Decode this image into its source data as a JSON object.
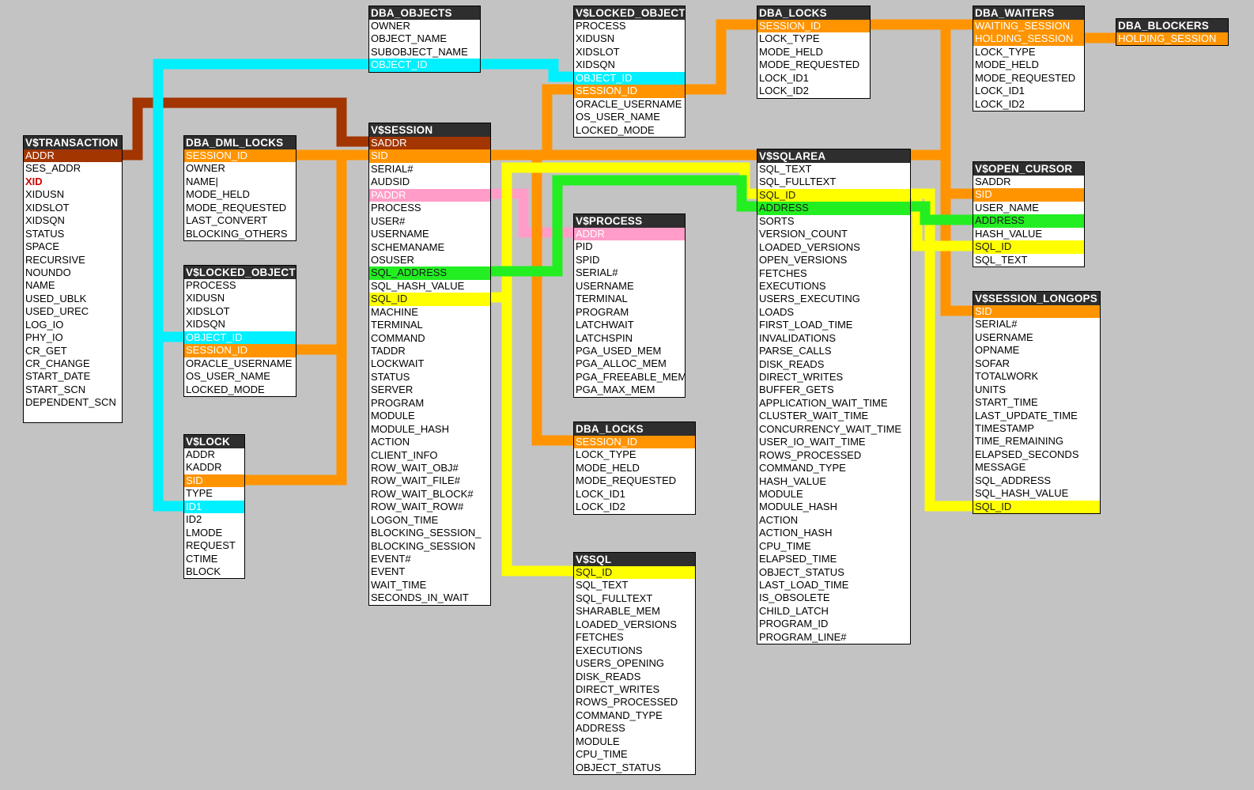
{
  "colors": {
    "background": "#c3c3c3",
    "header": "#2e2e2e",
    "orange": "#ff9400",
    "cyan": "#00f0ff",
    "brown": "#a23500",
    "yellow": "#ffff00",
    "green": "#22ee22",
    "pink": "#ff9cc8",
    "red_text": "#d00000"
  },
  "tables": [
    {
      "id": "vtransaction",
      "title": "V$TRANSACTION",
      "fields": [
        {
          "name": "ADDR",
          "hl": "brown"
        },
        {
          "name": "SES_ADDR"
        },
        {
          "name": "XID",
          "style": "red"
        },
        {
          "name": "XIDUSN"
        },
        {
          "name": "XIDSLOT"
        },
        {
          "name": "XIDSQN"
        },
        {
          "name": "STATUS"
        },
        {
          "name": "SPACE"
        },
        {
          "name": "RECURSIVE"
        },
        {
          "name": "NOUNDO"
        },
        {
          "name": "NAME"
        },
        {
          "name": "USED_UBLK"
        },
        {
          "name": "USED_UREC"
        },
        {
          "name": "LOG_IO"
        },
        {
          "name": "PHY_IO"
        },
        {
          "name": "CR_GET"
        },
        {
          "name": "CR_CHANGE"
        },
        {
          "name": "START_DATE"
        },
        {
          "name": "START_SCN"
        },
        {
          "name": "DEPENDENT_SCN"
        },
        {
          "name": ""
        }
      ]
    },
    {
      "id": "dbadmllocks",
      "title": "DBA_DML_LOCKS",
      "fields": [
        {
          "name": "SESSION_ID",
          "hl": "orange"
        },
        {
          "name": "OWNER"
        },
        {
          "name": "NAME|"
        },
        {
          "name": "MODE_HELD"
        },
        {
          "name": "MODE_REQUESTED"
        },
        {
          "name": "LAST_CONVERT"
        },
        {
          "name": "BLOCKING_OTHERS"
        }
      ]
    },
    {
      "id": "vlockedobject1",
      "title": "V$LOCKED_OBJECT",
      "fields": [
        {
          "name": "PROCESS"
        },
        {
          "name": "XIDUSN"
        },
        {
          "name": "XIDSLOT"
        },
        {
          "name": "XIDSQN"
        },
        {
          "name": "OBJECT_ID",
          "hl": "cyan"
        },
        {
          "name": "SESSION_ID",
          "hl": "orange"
        },
        {
          "name": "ORACLE_USERNAME"
        },
        {
          "name": "OS_USER_NAME"
        },
        {
          "name": "LOCKED_MODE"
        }
      ]
    },
    {
      "id": "vlock",
      "title": "V$LOCK",
      "fields": [
        {
          "name": "ADDR"
        },
        {
          "name": "KADDR"
        },
        {
          "name": "SID",
          "hl": "orange"
        },
        {
          "name": "TYPE"
        },
        {
          "name": "ID1",
          "hl": "cyan"
        },
        {
          "name": "ID2"
        },
        {
          "name": "LMODE"
        },
        {
          "name": "REQUEST"
        },
        {
          "name": "CTIME"
        },
        {
          "name": "BLOCK"
        }
      ]
    },
    {
      "id": "dbaobjects",
      "title": "DBA_OBJECTS",
      "fields": [
        {
          "name": "OWNER"
        },
        {
          "name": "OBJECT_NAME"
        },
        {
          "name": "SUBOBJECT_NAME"
        },
        {
          "name": "OBJECT_ID",
          "hl": "cyan"
        }
      ]
    },
    {
      "id": "vsession",
      "title": "V$SESSION",
      "fields": [
        {
          "name": "SADDR",
          "hl": "brown"
        },
        {
          "name": "SID",
          "hl": "orange"
        },
        {
          "name": "SERIAL#"
        },
        {
          "name": "AUDSID"
        },
        {
          "name": "PADDR",
          "hl": "pink"
        },
        {
          "name": "PROCESS"
        },
        {
          "name": "USER#"
        },
        {
          "name": "USERNAME"
        },
        {
          "name": "SCHEMANAME"
        },
        {
          "name": "OSUSER"
        },
        {
          "name": "SQL_ADDRESS",
          "hl": "green"
        },
        {
          "name": "SQL_HASH_VALUE"
        },
        {
          "name": "SQL_ID",
          "hl": "yellow"
        },
        {
          "name": "MACHINE"
        },
        {
          "name": "TERMINAL"
        },
        {
          "name": "COMMAND"
        },
        {
          "name": "TADDR"
        },
        {
          "name": "LOCKWAIT"
        },
        {
          "name": "STATUS"
        },
        {
          "name": "SERVER"
        },
        {
          "name": "PROGRAM"
        },
        {
          "name": "MODULE"
        },
        {
          "name": "MODULE_HASH"
        },
        {
          "name": "ACTION"
        },
        {
          "name": "CLIENT_INFO"
        },
        {
          "name": "ROW_WAIT_OBJ#"
        },
        {
          "name": "ROW_WAIT_FILE#"
        },
        {
          "name": "ROW_WAIT_BLOCK#"
        },
        {
          "name": "ROW_WAIT_ROW#"
        },
        {
          "name": "LOGON_TIME"
        },
        {
          "name": "BLOCKING_SESSION_"
        },
        {
          "name": "BLOCKING_SESSION"
        },
        {
          "name": "EVENT#"
        },
        {
          "name": "EVENT"
        },
        {
          "name": "WAIT_TIME"
        },
        {
          "name": "SECONDS_IN_WAIT"
        }
      ]
    },
    {
      "id": "vlockedobject2",
      "title": "V$LOCKED_OBJECT",
      "fields": [
        {
          "name": "PROCESS"
        },
        {
          "name": "XIDUSN"
        },
        {
          "name": "XIDSLOT"
        },
        {
          "name": "XIDSQN"
        },
        {
          "name": "OBJECT_ID",
          "hl": "cyan"
        },
        {
          "name": "SESSION_ID",
          "hl": "orange"
        },
        {
          "name": "ORACLE_USERNAME"
        },
        {
          "name": "OS_USER_NAME"
        },
        {
          "name": "LOCKED_MODE"
        }
      ]
    },
    {
      "id": "vprocess",
      "title": "V$PROCESS",
      "fields": [
        {
          "name": "ADDR",
          "hl": "pink"
        },
        {
          "name": "PID"
        },
        {
          "name": "SPID"
        },
        {
          "name": "SERIAL#"
        },
        {
          "name": "USERNAME"
        },
        {
          "name": "TERMINAL"
        },
        {
          "name": "PROGRAM"
        },
        {
          "name": "LATCHWAIT"
        },
        {
          "name": "LATCHSPIN"
        },
        {
          "name": "PGA_USED_MEM"
        },
        {
          "name": "PGA_ALLOC_MEM"
        },
        {
          "name": "PGA_FREEABLE_MEM"
        },
        {
          "name": "PGA_MAX_MEM"
        }
      ]
    },
    {
      "id": "dbalocks2",
      "title": "DBA_LOCKS",
      "fields": [
        {
          "name": "SESSION_ID",
          "hl": "orange"
        },
        {
          "name": "LOCK_TYPE"
        },
        {
          "name": "MODE_HELD"
        },
        {
          "name": "MODE_REQUESTED"
        },
        {
          "name": "LOCK_ID1"
        },
        {
          "name": "LOCK_ID2"
        }
      ]
    },
    {
      "id": "vsql",
      "title": "V$SQL",
      "fields": [
        {
          "name": "SQL_ID",
          "hl": "yellow"
        },
        {
          "name": "SQL_TEXT"
        },
        {
          "name": "SQL_FULLTEXT"
        },
        {
          "name": "SHARABLE_MEM"
        },
        {
          "name": "LOADED_VERSIONS"
        },
        {
          "name": "FETCHES"
        },
        {
          "name": "EXECUTIONS"
        },
        {
          "name": "USERS_OPENING"
        },
        {
          "name": "DISK_READS"
        },
        {
          "name": "DIRECT_WRITES"
        },
        {
          "name": "ROWS_PROCESSED"
        },
        {
          "name": "COMMAND_TYPE"
        },
        {
          "name": "ADDRESS"
        },
        {
          "name": "MODULE"
        },
        {
          "name": "CPU_TIME"
        },
        {
          "name": "OBJECT_STATUS"
        }
      ]
    },
    {
      "id": "dbalocks1",
      "title": "DBA_LOCKS",
      "fields": [
        {
          "name": "SESSION_ID",
          "hl": "orange"
        },
        {
          "name": "LOCK_TYPE"
        },
        {
          "name": "MODE_HELD"
        },
        {
          "name": "MODE_REQUESTED"
        },
        {
          "name": "LOCK_ID1"
        },
        {
          "name": "LOCK_ID2"
        }
      ]
    },
    {
      "id": "vsqlarea",
      "title": "V$SQLAREA",
      "fields": [
        {
          "name": "SQL_TEXT"
        },
        {
          "name": "SQL_FULLTEXT"
        },
        {
          "name": "SQL_ID",
          "hl": "yellow"
        },
        {
          "name": "ADDRESS",
          "hl": "green"
        },
        {
          "name": "SORTS"
        },
        {
          "name": "VERSION_COUNT"
        },
        {
          "name": "LOADED_VERSIONS"
        },
        {
          "name": "OPEN_VERSIONS"
        },
        {
          "name": "FETCHES"
        },
        {
          "name": "EXECUTIONS"
        },
        {
          "name": "USERS_EXECUTING"
        },
        {
          "name": "LOADS"
        },
        {
          "name": "FIRST_LOAD_TIME"
        },
        {
          "name": "INVALIDATIONS"
        },
        {
          "name": "PARSE_CALLS"
        },
        {
          "name": "DISK_READS"
        },
        {
          "name": "DIRECT_WRITES"
        },
        {
          "name": "BUFFER_GETS"
        },
        {
          "name": "APPLICATION_WAIT_TIME"
        },
        {
          "name": "CLUSTER_WAIT_TIME"
        },
        {
          "name": "CONCURRENCY_WAIT_TIME"
        },
        {
          "name": "USER_IO_WAIT_TIME"
        },
        {
          "name": "ROWS_PROCESSED"
        },
        {
          "name": "COMMAND_TYPE"
        },
        {
          "name": "HASH_VALUE"
        },
        {
          "name": "MODULE"
        },
        {
          "name": "MODULE_HASH"
        },
        {
          "name": "ACTION"
        },
        {
          "name": "ACTION_HASH"
        },
        {
          "name": "CPU_TIME"
        },
        {
          "name": "ELAPSED_TIME"
        },
        {
          "name": "OBJECT_STATUS"
        },
        {
          "name": "LAST_LOAD_TIME"
        },
        {
          "name": "IS_OBSOLETE"
        },
        {
          "name": "CHILD_LATCH"
        },
        {
          "name": "PROGRAM_ID"
        },
        {
          "name": "PROGRAM_LINE#"
        }
      ]
    },
    {
      "id": "dbawaiters",
      "title": "DBA_WAITERS",
      "fields": [
        {
          "name": "WAITING_SESSION",
          "hl": "orange"
        },
        {
          "name": "HOLDING_SESSION",
          "hl": "orange"
        },
        {
          "name": "LOCK_TYPE"
        },
        {
          "name": "MODE_HELD"
        },
        {
          "name": "MODE_REQUESTED"
        },
        {
          "name": "LOCK_ID1"
        },
        {
          "name": "LOCK_ID2"
        }
      ]
    },
    {
      "id": "dbablockers",
      "title": "DBA_BLOCKERS",
      "fields": [
        {
          "name": "HOLDING_SESSION",
          "hl": "orange"
        }
      ]
    },
    {
      "id": "vopencursor",
      "title": "V$OPEN_CURSOR",
      "fields": [
        {
          "name": "SADDR"
        },
        {
          "name": "SID",
          "hl": "orange"
        },
        {
          "name": "USER_NAME"
        },
        {
          "name": "ADDRESS",
          "hl": "green"
        },
        {
          "name": "HASH_VALUE"
        },
        {
          "name": "SQL_ID",
          "hl": "yellow"
        },
        {
          "name": "SQL_TEXT"
        }
      ]
    },
    {
      "id": "vsessionlongops",
      "title": "V$SESSION_LONGOPS",
      "fields": [
        {
          "name": "SID",
          "hl": "orange"
        },
        {
          "name": "SERIAL#"
        },
        {
          "name": "USERNAME"
        },
        {
          "name": "OPNAME"
        },
        {
          "name": "SOFAR"
        },
        {
          "name": "TOTALWORK"
        },
        {
          "name": "UNITS"
        },
        {
          "name": "START_TIME"
        },
        {
          "name": "LAST_UPDATE_TIME"
        },
        {
          "name": "TIMESTAMP"
        },
        {
          "name": "TIME_REMAINING"
        },
        {
          "name": "ELAPSED_SECONDS"
        },
        {
          "name": "MESSAGE"
        },
        {
          "name": "SQL_ADDRESS"
        },
        {
          "name": "SQL_HASH_VALUE"
        },
        {
          "name": "SQL_ID",
          "hl": "yellow"
        }
      ]
    }
  ]
}
